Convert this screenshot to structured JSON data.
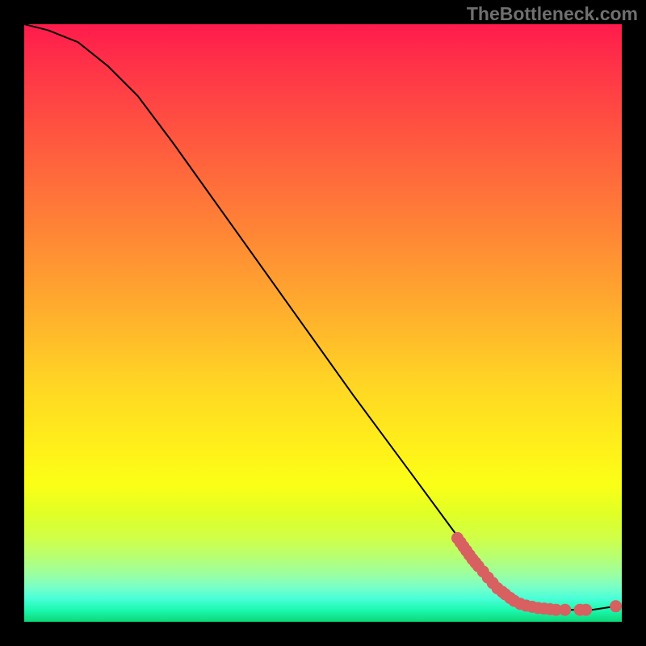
{
  "watermark": "TheBottleneck.com",
  "chart_data": {
    "type": "line",
    "title": "",
    "xlabel": "",
    "ylabel": "",
    "xlim": [
      0,
      100
    ],
    "ylim": [
      0,
      100
    ],
    "curve": [
      {
        "x": 0,
        "y": 100
      },
      {
        "x": 4,
        "y": 99
      },
      {
        "x": 9,
        "y": 97
      },
      {
        "x": 14,
        "y": 93
      },
      {
        "x": 19,
        "y": 88
      },
      {
        "x": 25,
        "y": 80
      },
      {
        "x": 35,
        "y": 66
      },
      {
        "x": 45,
        "y": 52
      },
      {
        "x": 55,
        "y": 38
      },
      {
        "x": 65,
        "y": 24.5
      },
      {
        "x": 72,
        "y": 15
      },
      {
        "x": 76,
        "y": 9.5
      },
      {
        "x": 80,
        "y": 5
      },
      {
        "x": 83,
        "y": 3
      },
      {
        "x": 86,
        "y": 2.2
      },
      {
        "x": 90,
        "y": 2.0
      },
      {
        "x": 95,
        "y": 2.0
      },
      {
        "x": 99,
        "y": 2.6
      }
    ],
    "points": [
      {
        "x": 72.5,
        "y": 14.0
      },
      {
        "x": 73.0,
        "y": 13.3
      },
      {
        "x": 73.5,
        "y": 12.6
      },
      {
        "x": 74.0,
        "y": 11.9
      },
      {
        "x": 74.5,
        "y": 11.2
      },
      {
        "x": 75.0,
        "y": 10.5
      },
      {
        "x": 75.5,
        "y": 9.9
      },
      {
        "x": 76.0,
        "y": 9.3
      },
      {
        "x": 76.8,
        "y": 8.4
      },
      {
        "x": 77.6,
        "y": 7.4
      },
      {
        "x": 78.4,
        "y": 6.5
      },
      {
        "x": 79.2,
        "y": 5.6
      },
      {
        "x": 80.0,
        "y": 5.0
      },
      {
        "x": 80.5,
        "y": 4.6
      },
      {
        "x": 81.3,
        "y": 4.0
      },
      {
        "x": 82.0,
        "y": 3.5
      },
      {
        "x": 83.0,
        "y": 3.0
      },
      {
        "x": 84.0,
        "y": 2.7
      },
      {
        "x": 85.0,
        "y": 2.5
      },
      {
        "x": 86.0,
        "y": 2.3
      },
      {
        "x": 87.0,
        "y": 2.2
      },
      {
        "x": 88.0,
        "y": 2.1
      },
      {
        "x": 89.0,
        "y": 2.0
      },
      {
        "x": 90.5,
        "y": 2.0
      },
      {
        "x": 93.0,
        "y": 2.0
      },
      {
        "x": 94.0,
        "y": 2.0
      },
      {
        "x": 99.0,
        "y": 2.6
      }
    ],
    "colors": {
      "curve_stroke": "#000000",
      "point_fill": "#d86060",
      "point_stroke": "#000000"
    }
  }
}
